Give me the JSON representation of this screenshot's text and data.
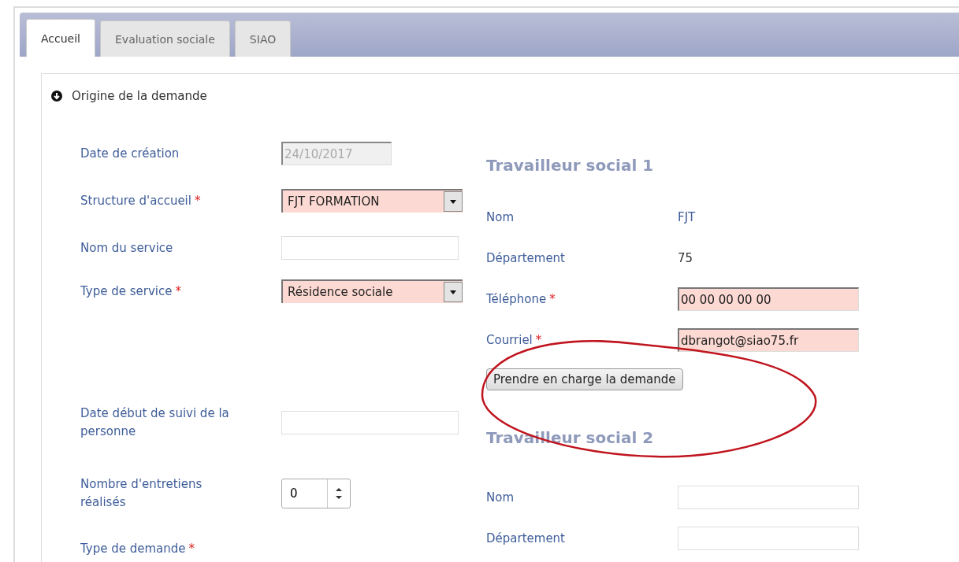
{
  "tabs": [
    {
      "label": "Accueil",
      "selected": true
    },
    {
      "label": "Evaluation sociale",
      "selected": false
    },
    {
      "label": "SIAO",
      "selected": false
    }
  ],
  "section": {
    "title": "Origine de la demande",
    "expanded": true
  },
  "left_fields": [
    {
      "label": "Date de création",
      "kind": "text",
      "value": "24/10/2017",
      "disabled": true
    },
    {
      "label": "Structure d'accueil",
      "required_mark": "*",
      "kind": "select",
      "value": "FJT FORMATION"
    },
    {
      "label": "Nom du service",
      "kind": "text",
      "disabled": false
    },
    {
      "label": "Type de service",
      "required_mark": "*",
      "kind": "select",
      "value": "Résidence sociale"
    },
    {
      "label": "Date début de suivi de la personne",
      "kind": "text",
      "disabled": false
    },
    {
      "label": "Nombre d'entretiens réalisés",
      "kind": "number",
      "value": "0"
    },
    {
      "label": "Type de demande",
      "required_mark": "*",
      "kind": "none"
    }
  ],
  "worker_1": {
    "title": "Travailleur social 1",
    "fields": [
      {
        "label": "Nom",
        "kind": "static",
        "value": "FJT"
      },
      {
        "label": "Département",
        "kind": "static",
        "value": "75"
      },
      {
        "label": "Téléphone",
        "required_mark": "*",
        "kind": "text",
        "value": "00 00 00 00 00"
      },
      {
        "label": "Courriel",
        "required_mark": "*",
        "kind": "text",
        "value": "dbrangot@siao75.fr"
      }
    ]
  },
  "take_charge_button": "Prendre en charge la demande",
  "worker_2": {
    "title": "Travailleur social 2",
    "fields": [
      {
        "label": "Nom",
        "kind": "text"
      },
      {
        "label": "Département",
        "kind": "text"
      }
    ]
  },
  "annotation": {
    "kind": "ellipse",
    "color": "#c0141e"
  }
}
